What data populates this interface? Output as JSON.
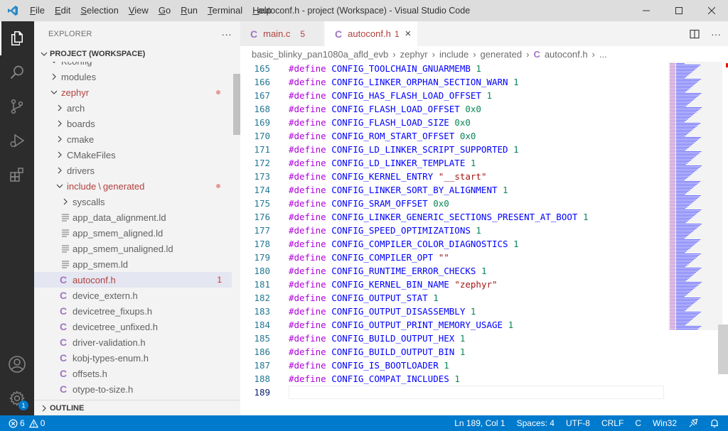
{
  "window": {
    "title": "autoconf.h - project (Workspace) - Visual Studio Code",
    "menu": [
      {
        "underline": "F",
        "rest": "ile"
      },
      {
        "underline": "E",
        "rest": "dit"
      },
      {
        "underline": "S",
        "rest": "election"
      },
      {
        "underline": "V",
        "rest": "iew"
      },
      {
        "underline": "G",
        "rest": "o"
      },
      {
        "underline": "R",
        "rest": "un"
      },
      {
        "underline": "T",
        "rest": "erminal"
      },
      {
        "underline": "H",
        "rest": "elp"
      }
    ]
  },
  "activity_bar": {
    "icons": [
      "explorer-icon",
      "search-icon",
      "source-control-icon",
      "run-debug-icon",
      "extensions-icon",
      "account-icon",
      "settings-gear-icon"
    ],
    "settings_badge": "1"
  },
  "explorer": {
    "title": "EXPLORER",
    "more": "···",
    "workspace": "PROJECT (WORKSPACE)",
    "outline": "OUTLINE",
    "rows": [
      {
        "label": "Kconfig",
        "type": "folder",
        "open": true,
        "indent": 1,
        "partial": true
      },
      {
        "label": "modules",
        "type": "folder",
        "open": false,
        "indent": 1
      },
      {
        "label": "zephyr",
        "type": "folder",
        "open": true,
        "indent": 1,
        "red": true,
        "dot": true
      },
      {
        "label": "arch",
        "type": "folder",
        "open": false,
        "indent": 2
      },
      {
        "label": "boards",
        "type": "folder",
        "open": false,
        "indent": 2
      },
      {
        "label": "cmake",
        "type": "folder",
        "open": false,
        "indent": 2
      },
      {
        "label": "CMakeFiles",
        "type": "folder",
        "open": false,
        "indent": 2
      },
      {
        "label": "drivers",
        "type": "folder",
        "open": false,
        "indent": 2
      },
      {
        "label": "include",
        "label2": "generated",
        "type": "folder",
        "open": true,
        "indent": 2,
        "red": true,
        "dot": true
      },
      {
        "label": "syscalls",
        "type": "folder",
        "open": false,
        "indent": 3
      },
      {
        "label": "app_data_alignment.ld",
        "type": "lines",
        "indent": 3
      },
      {
        "label": "app_smem_aligned.ld",
        "type": "lines",
        "indent": 3
      },
      {
        "label": "app_smem_unaligned.ld",
        "type": "lines",
        "indent": 3
      },
      {
        "label": "app_smem.ld",
        "type": "lines",
        "indent": 3
      },
      {
        "label": "autoconf.h",
        "type": "c",
        "indent": 3,
        "red": true,
        "selected": true,
        "count": "1"
      },
      {
        "label": "device_extern.h",
        "type": "c",
        "indent": 3
      },
      {
        "label": "devicetree_fixups.h",
        "type": "c",
        "indent": 3
      },
      {
        "label": "devicetree_unfixed.h",
        "type": "c",
        "indent": 3
      },
      {
        "label": "driver-validation.h",
        "type": "c",
        "indent": 3
      },
      {
        "label": "kobj-types-enum.h",
        "type": "c",
        "indent": 3
      },
      {
        "label": "offsets.h",
        "type": "c",
        "indent": 3
      },
      {
        "label": "otype-to-size.h",
        "type": "c",
        "indent": 3
      }
    ]
  },
  "tabs": [
    {
      "label": "main.c",
      "count": "5",
      "active": false
    },
    {
      "label": "autoconf.h",
      "count": "1",
      "active": true,
      "close": "×"
    }
  ],
  "breadcrumbs": [
    "basic_blinky_pan1080a_afld_evb",
    "zephyr",
    "include",
    "generated",
    "autoconf.h",
    "..."
  ],
  "editor": {
    "lines": [
      {
        "n": "165",
        "name": "CONFIG_TOOLCHAIN_GNUARMEMB",
        "value": "1",
        "kind": "num"
      },
      {
        "n": "166",
        "name": "CONFIG_LINKER_ORPHAN_SECTION_WARN",
        "value": "1",
        "kind": "num"
      },
      {
        "n": "167",
        "name": "CONFIG_HAS_FLASH_LOAD_OFFSET",
        "value": "1",
        "kind": "num"
      },
      {
        "n": "168",
        "name": "CONFIG_FLASH_LOAD_OFFSET",
        "value": "0x0",
        "kind": "num"
      },
      {
        "n": "169",
        "name": "CONFIG_FLASH_LOAD_SIZE",
        "value": "0x0",
        "kind": "num"
      },
      {
        "n": "170",
        "name": "CONFIG_ROM_START_OFFSET",
        "value": "0x0",
        "kind": "num"
      },
      {
        "n": "171",
        "name": "CONFIG_LD_LINKER_SCRIPT_SUPPORTED",
        "value": "1",
        "kind": "num"
      },
      {
        "n": "172",
        "name": "CONFIG_LD_LINKER_TEMPLATE",
        "value": "1",
        "kind": "num"
      },
      {
        "n": "173",
        "name": "CONFIG_KERNEL_ENTRY",
        "value": "\"__start\"",
        "kind": "str"
      },
      {
        "n": "174",
        "name": "CONFIG_LINKER_SORT_BY_ALIGNMENT",
        "value": "1",
        "kind": "num"
      },
      {
        "n": "175",
        "name": "CONFIG_SRAM_OFFSET",
        "value": "0x0",
        "kind": "num"
      },
      {
        "n": "176",
        "name": "CONFIG_LINKER_GENERIC_SECTIONS_PRESENT_AT_BOOT",
        "value": "1",
        "kind": "num"
      },
      {
        "n": "177",
        "name": "CONFIG_SPEED_OPTIMIZATIONS",
        "value": "1",
        "kind": "num"
      },
      {
        "n": "178",
        "name": "CONFIG_COMPILER_COLOR_DIAGNOSTICS",
        "value": "1",
        "kind": "num"
      },
      {
        "n": "179",
        "name": "CONFIG_COMPILER_OPT",
        "value": "\"\"",
        "kind": "str"
      },
      {
        "n": "180",
        "name": "CONFIG_RUNTIME_ERROR_CHECKS",
        "value": "1",
        "kind": "num"
      },
      {
        "n": "181",
        "name": "CONFIG_KERNEL_BIN_NAME",
        "value": "\"zephyr\"",
        "kind": "str"
      },
      {
        "n": "182",
        "name": "CONFIG_OUTPUT_STAT",
        "value": "1",
        "kind": "num"
      },
      {
        "n": "183",
        "name": "CONFIG_OUTPUT_DISASSEMBLY",
        "value": "1",
        "kind": "num"
      },
      {
        "n": "184",
        "name": "CONFIG_OUTPUT_PRINT_MEMORY_USAGE",
        "value": "1",
        "kind": "num"
      },
      {
        "n": "185",
        "name": "CONFIG_BUILD_OUTPUT_HEX",
        "value": "1",
        "kind": "num"
      },
      {
        "n": "186",
        "name": "CONFIG_BUILD_OUTPUT_BIN",
        "value": "1",
        "kind": "num"
      },
      {
        "n": "187",
        "name": "CONFIG_IS_BOOTLOADER",
        "value": "1",
        "kind": "num"
      },
      {
        "n": "188",
        "name": "CONFIG_COMPAT_INCLUDES",
        "value": "1",
        "kind": "num"
      },
      {
        "n": "189",
        "name": "",
        "value": "",
        "kind": "empty",
        "current": true
      }
    ],
    "define_keyword": "#define"
  },
  "status_bar": {
    "errors": "6",
    "warnings": "0",
    "position": "Ln 189, Col 1",
    "spaces": "Spaces: 4",
    "encoding": "UTF-8",
    "eol": "CRLF",
    "language": "C",
    "platform": "Win32"
  },
  "colors": {
    "accent": "#007acc",
    "activity_bar": "#2c2c2c",
    "macro": "#0000ff",
    "keyword": "#af00db",
    "number": "#098658",
    "string": "#a31515",
    "modified": "#b0413e"
  }
}
